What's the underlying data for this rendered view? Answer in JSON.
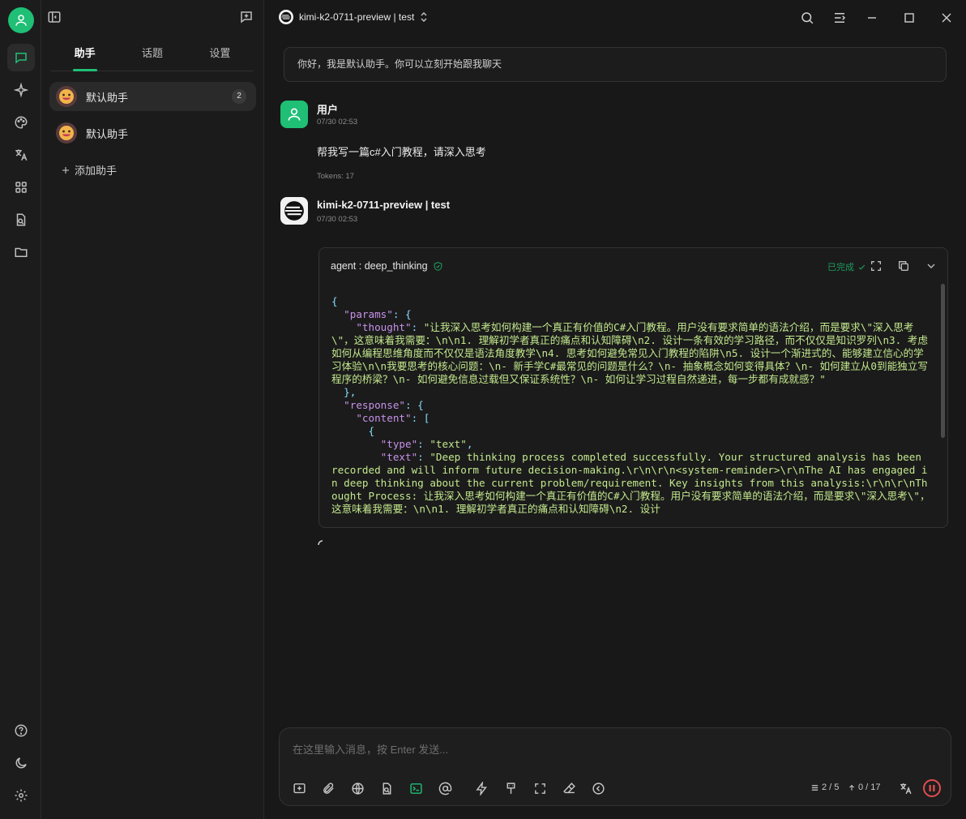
{
  "colors": {
    "accent": "#1fbf75",
    "danger": "#e24d4d",
    "json_key": "#c792ea",
    "json_string": "#c3e88d"
  },
  "sidebar": {
    "tabs": [
      {
        "label": "助手",
        "active": true
      },
      {
        "label": "话题",
        "active": false
      },
      {
        "label": "设置",
        "active": false
      }
    ],
    "assistants": [
      {
        "name": "默认助手",
        "badge": "2",
        "active": true
      },
      {
        "name": "默认助手",
        "badge": "",
        "active": false
      }
    ],
    "add_label": "添加助手"
  },
  "header": {
    "model_label": "kimi-k2-0711-preview | test"
  },
  "chat": {
    "greeting": "你好，我是默认助手。你可以立刻开始跟我聊天",
    "user_message": {
      "name": "用户",
      "time": "07/30 02:53",
      "text": "帮我写一篇c#入门教程，请深入思考",
      "tokens": "Tokens: 17"
    },
    "assistant_message": {
      "name": "kimi-k2-0711-preview | test",
      "time": "07/30 02:53"
    },
    "tool_call": {
      "title": "agent : deep_thinking",
      "status": "已完成",
      "json": {
        "open": "{",
        "params_key": "\"params\"",
        "thought_key": "\"thought\"",
        "thought_value": "\"让我深入思考如何构建一个真正有价值的C#入门教程。用户没有要求简单的语法介绍，而是要求\\\"深入思考\\\"，这意味着我需要：\\n\\n1. 理解初学者真正的痛点和认知障碍\\n2. 设计一条有效的学习路径，而不仅仅是知识罗列\\n3. 考虑如何从编程思维角度而不仅仅是语法角度教学\\n4. 思考如何避免常见入门教程的陷阱\\n5. 设计一个渐进式的、能够建立信心的学习体验\\n\\n我要思考的核心问题：\\n- 新手学C#最常见的问题是什么？\\n- 抽象概念如何变得具体？\\n- 如何建立从0到能独立写程序的桥梁？\\n- 如何避免信息过载但又保证系统性？\\n- 如何让学习过程自然递进，每一步都有成就感？\"",
        "params_close": "},",
        "response_key": "\"response\"",
        "content_key": "\"content\"",
        "type_key": "\"type\"",
        "type_value": "\"text\"",
        "text_key": "\"text\"",
        "text_value": "\"Deep thinking process completed successfully. Your structured analysis has been recorded and will inform future decision-making.\\r\\n\\r\\n<system-reminder>\\r\\nThe AI has engaged in deep thinking about the current problem/requirement. Key insights from this analysis:\\r\\n\\r\\nThought Process: 让我深入思考如何构建一个真正有价值的C#入门教程。用户没有要求简单的语法介绍，而是要求\\\"深入思考\\\"，这意味着我需要：\\n\\n1. 理解初学者真正的痛点和认知障碍\\n2. 设计"
      }
    }
  },
  "composer": {
    "placeholder": "在这里输入消息，按 Enter 发送...",
    "context_count": "2 / 5",
    "token_count": "0 / 17"
  }
}
